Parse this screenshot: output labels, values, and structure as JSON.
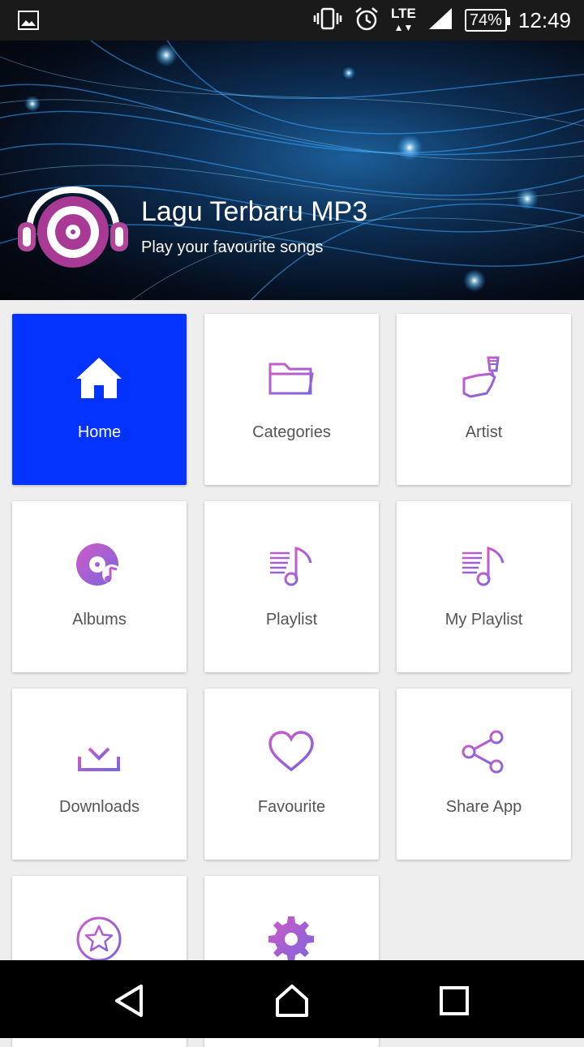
{
  "status_bar": {
    "network": "LTE",
    "battery": "74%",
    "time": "12:49",
    "icons": [
      "image-icon",
      "vibrate-icon",
      "alarm-icon",
      "signal-icon",
      "battery-icon"
    ]
  },
  "header": {
    "title": "Lagu Terbaru MP3",
    "subtitle": "Play your favourite songs"
  },
  "menu": [
    {
      "label": "Home",
      "icon": "home-icon",
      "active": true
    },
    {
      "label": "Categories",
      "icon": "folder-icon",
      "active": false
    },
    {
      "label": "Artist",
      "icon": "artist-icon",
      "active": false
    },
    {
      "label": "Albums",
      "icon": "album-icon",
      "active": false
    },
    {
      "label": "Playlist",
      "icon": "playlist-icon",
      "active": false
    },
    {
      "label": "My Playlist",
      "icon": "my-playlist-icon",
      "active": false
    },
    {
      "label": "Downloads",
      "icon": "download-icon",
      "active": false
    },
    {
      "label": "Favourite",
      "icon": "heart-icon",
      "active": false
    },
    {
      "label": "Share App",
      "icon": "share-icon",
      "active": false
    },
    {
      "label": "",
      "icon": "star-icon",
      "active": false
    },
    {
      "label": "",
      "icon": "gear-icon",
      "active": false
    }
  ],
  "colors": {
    "accent": "#0433ff",
    "icon_gradient_start": "#c05bd6",
    "icon_gradient_end": "#7b6bd9"
  },
  "nav_bar": [
    "back-icon",
    "home-nav-icon",
    "recents-icon"
  ]
}
